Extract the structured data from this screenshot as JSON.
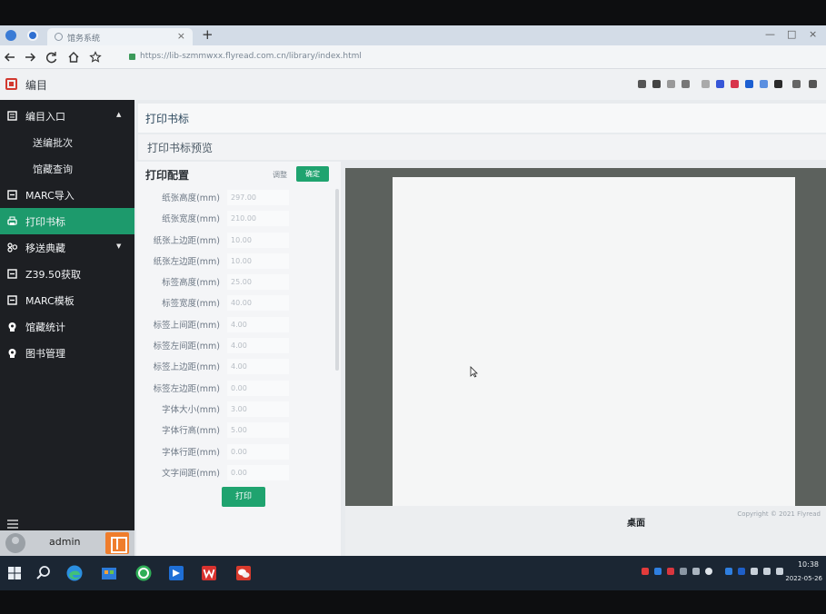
{
  "browser": {
    "tab_title": "馆务系统",
    "tab_close": "×",
    "new_tab": "+",
    "url": "https://lib-szmmwxx.flyread.com.cn/library/index.html",
    "window_controls": {
      "minimize": "—",
      "maximize": "□",
      "close": "×"
    },
    "nav_icons": [
      "back-icon",
      "forward-icon",
      "reload-icon",
      "home-icon",
      "star-icon"
    ]
  },
  "app": {
    "title": "编目",
    "logo_icon": "catalog-logo-icon"
  },
  "sidebar": {
    "items": [
      {
        "label": "编目入口",
        "icon": "catalog-icon",
        "caret": "▲"
      },
      {
        "label": "送编批次"
      },
      {
        "label": "馆藏查询"
      },
      {
        "label": "MARC导入",
        "icon": "import-icon"
      },
      {
        "label": "打印书标",
        "icon": "print-icon",
        "active": true
      },
      {
        "label": "移送典藏",
        "icon": "transfer-icon",
        "caret": "▼"
      },
      {
        "label": "Z39.50获取",
        "icon": "fetch-icon"
      },
      {
        "label": "MARC模板",
        "icon": "template-icon"
      },
      {
        "label": "馆藏统计",
        "icon": "stats-icon"
      },
      {
        "label": "图书管理",
        "icon": "books-icon"
      }
    ],
    "menu_toggle_icon": "hamburger-icon",
    "user": {
      "name": "admin",
      "avatar_icon": "user-avatar-icon"
    }
  },
  "main": {
    "breadcrumb": "打印书标",
    "preview_title": "打印书标预览",
    "config": {
      "title": "打印配置",
      "adjust_label": "调整",
      "confirm_label": "确定",
      "print_label": "打印",
      "fields": [
        {
          "label": "纸张高度(mm)",
          "value": "297.00"
        },
        {
          "label": "纸张宽度(mm)",
          "value": "210.00"
        },
        {
          "label": "纸张上边距(mm)",
          "value": "10.00"
        },
        {
          "label": "纸张左边距(mm)",
          "value": "10.00"
        },
        {
          "label": "标签高度(mm)",
          "value": "25.00"
        },
        {
          "label": "标签宽度(mm)",
          "value": "40.00"
        },
        {
          "label": "标签上间距(mm)",
          "value": "4.00"
        },
        {
          "label": "标签左间距(mm)",
          "value": "4.00"
        },
        {
          "label": "标签上边距(mm)",
          "value": "4.00"
        },
        {
          "label": "标签左边距(mm)",
          "value": "0.00"
        },
        {
          "label": "字体大小(mm)",
          "value": "3.00"
        },
        {
          "label": "字体行高(mm)",
          "value": "5.00"
        },
        {
          "label": "字体行距(mm)",
          "value": "0.00"
        },
        {
          "label": "文字间距(mm)",
          "value": "0.00"
        }
      ]
    }
  },
  "footer": {
    "desktop_label": "桌面",
    "copyright": "Copyright © 2021 Flyread"
  },
  "taskbar": {
    "time": "10:38",
    "date": "2022-05-26",
    "pinned_icons": [
      "windows-start-icon",
      "search-icon",
      "edge-icon",
      "store-icon",
      "360-browser-icon",
      "blue-app-icon",
      "wps-icon",
      "chat-app-icon"
    ]
  },
  "colors": {
    "accent": "#1fa36f",
    "active_item": "#1d9a6c",
    "sidebar_bg": "#1d1f23",
    "preview_bg": "#5c615d"
  }
}
